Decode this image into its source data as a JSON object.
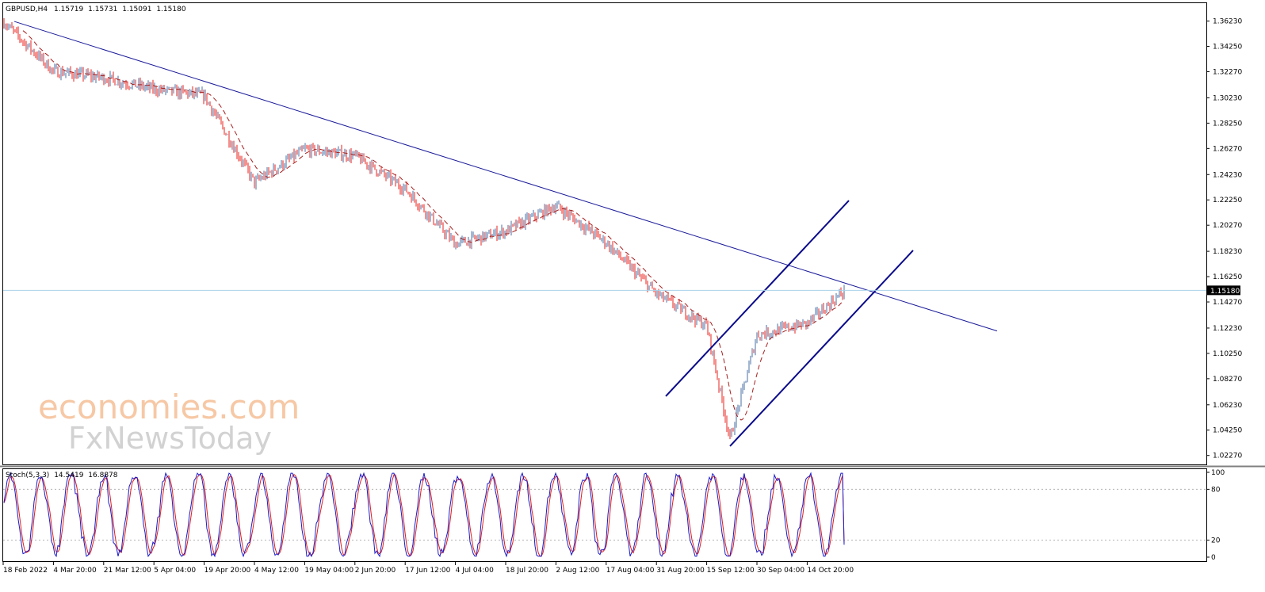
{
  "header": {
    "symbol": "GBPUSD,H4",
    "open": "1.15719",
    "high": "1.15731",
    "low": "1.15091",
    "close": "1.15180"
  },
  "stoch_header": {
    "label": "Stoch(5,3,3)",
    "k": "14.5419",
    "d": "16.8878"
  },
  "watermark": {
    "line1": "economies.com",
    "line2": "FxNewsToday"
  },
  "colors": {
    "bull_candle": "#4a6fa5",
    "bear_candle": "#e8211d",
    "moving_average": "#a52020",
    "trendline": "#1a1a9a",
    "channel": "#0a0a8a",
    "current_price_line": "#a9d2ea",
    "stoch_k": "#1a1ac8",
    "stoch_d": "#e01e1e",
    "grid_dots": "#b0b0b0",
    "watermark_orange": "#f6c8a5",
    "watermark_gray": "#d2d2d2"
  },
  "chart_data": [
    {
      "type": "candlestick",
      "symbol": "GBPUSD",
      "timeframe": "H4",
      "y_ticks": [
        "1.36230",
        "1.34250",
        "1.32270",
        "1.30230",
        "1.28250",
        "1.26270",
        "1.24230",
        "1.22250",
        "1.20270",
        "1.18230",
        "1.16250",
        "1.14270",
        "1.12230",
        "1.10250",
        "1.08270",
        "1.06230",
        "1.04250",
        "1.02270"
      ],
      "ylim": [
        1.0157,
        1.3763
      ],
      "current_price": "1.15180",
      "x_ticks": [
        "18 Feb 2022",
        "4 Mar 20:00",
        "21 Mar 12:00",
        "5 Apr 04:00",
        "19 Apr 20:00",
        "4 May 12:00",
        "19 May 04:00",
        "2 Jun 20:00",
        "17 Jun 12:00",
        "4 Jul 04:00",
        "18 Jul 20:00",
        "2 Aug 12:00",
        "17 Aug 04:00",
        "31 Aug 20:00",
        "15 Sep 12:00",
        "30 Sep 04:00",
        "14 Oct 20:00"
      ],
      "price_path": [
        [
          "18 Feb 2022",
          1.362
        ],
        [
          "4 Mar 20:00",
          1.323
        ],
        [
          "21 Mar 12:00",
          1.318
        ],
        [
          "5 Apr 04:00",
          1.309
        ],
        [
          "19 Apr 20:00",
          1.304
        ],
        [
          "4 May 12:00",
          1.236
        ],
        [
          "19 May 04:00",
          1.262
        ],
        [
          "2 Jun 20:00",
          1.257
        ],
        [
          "17 Jun 12:00",
          1.231
        ],
        [
          "4 Jul 04:00",
          1.188
        ],
        [
          "18 Jul 20:00",
          1.198
        ],
        [
          "2 Aug 12:00",
          1.218
        ],
        [
          "17 Aug 04:00",
          1.189
        ],
        [
          "31 Aug 20:00",
          1.149
        ],
        [
          "15 Sep 12:00",
          1.124
        ],
        [
          "26 Sep",
          1.035
        ],
        [
          "30 Sep 04:00",
          1.117
        ],
        [
          "14 Oct 20:00",
          1.126
        ],
        [
          "end",
          1.1518
        ]
      ],
      "trendline": {
        "from": [
          "18 Feb 2022",
          1.362
        ],
        "to": [
          "beyond last bar",
          1.12
        ]
      },
      "channel": {
        "upper": {
          "from": 1.069,
          "to": 1.222
        },
        "lower": {
          "from": 1.03,
          "to": 1.183
        }
      }
    },
    {
      "type": "line",
      "indicator": "Stochastic Oscillator",
      "params": [
        5,
        3,
        3
      ],
      "y_ticks": [
        "100",
        "80",
        "20",
        "0"
      ],
      "ylim": [
        0,
        100
      ],
      "levels": [
        80,
        20
      ],
      "last_values": {
        "k": 14.5419,
        "d": 16.8878
      }
    }
  ]
}
